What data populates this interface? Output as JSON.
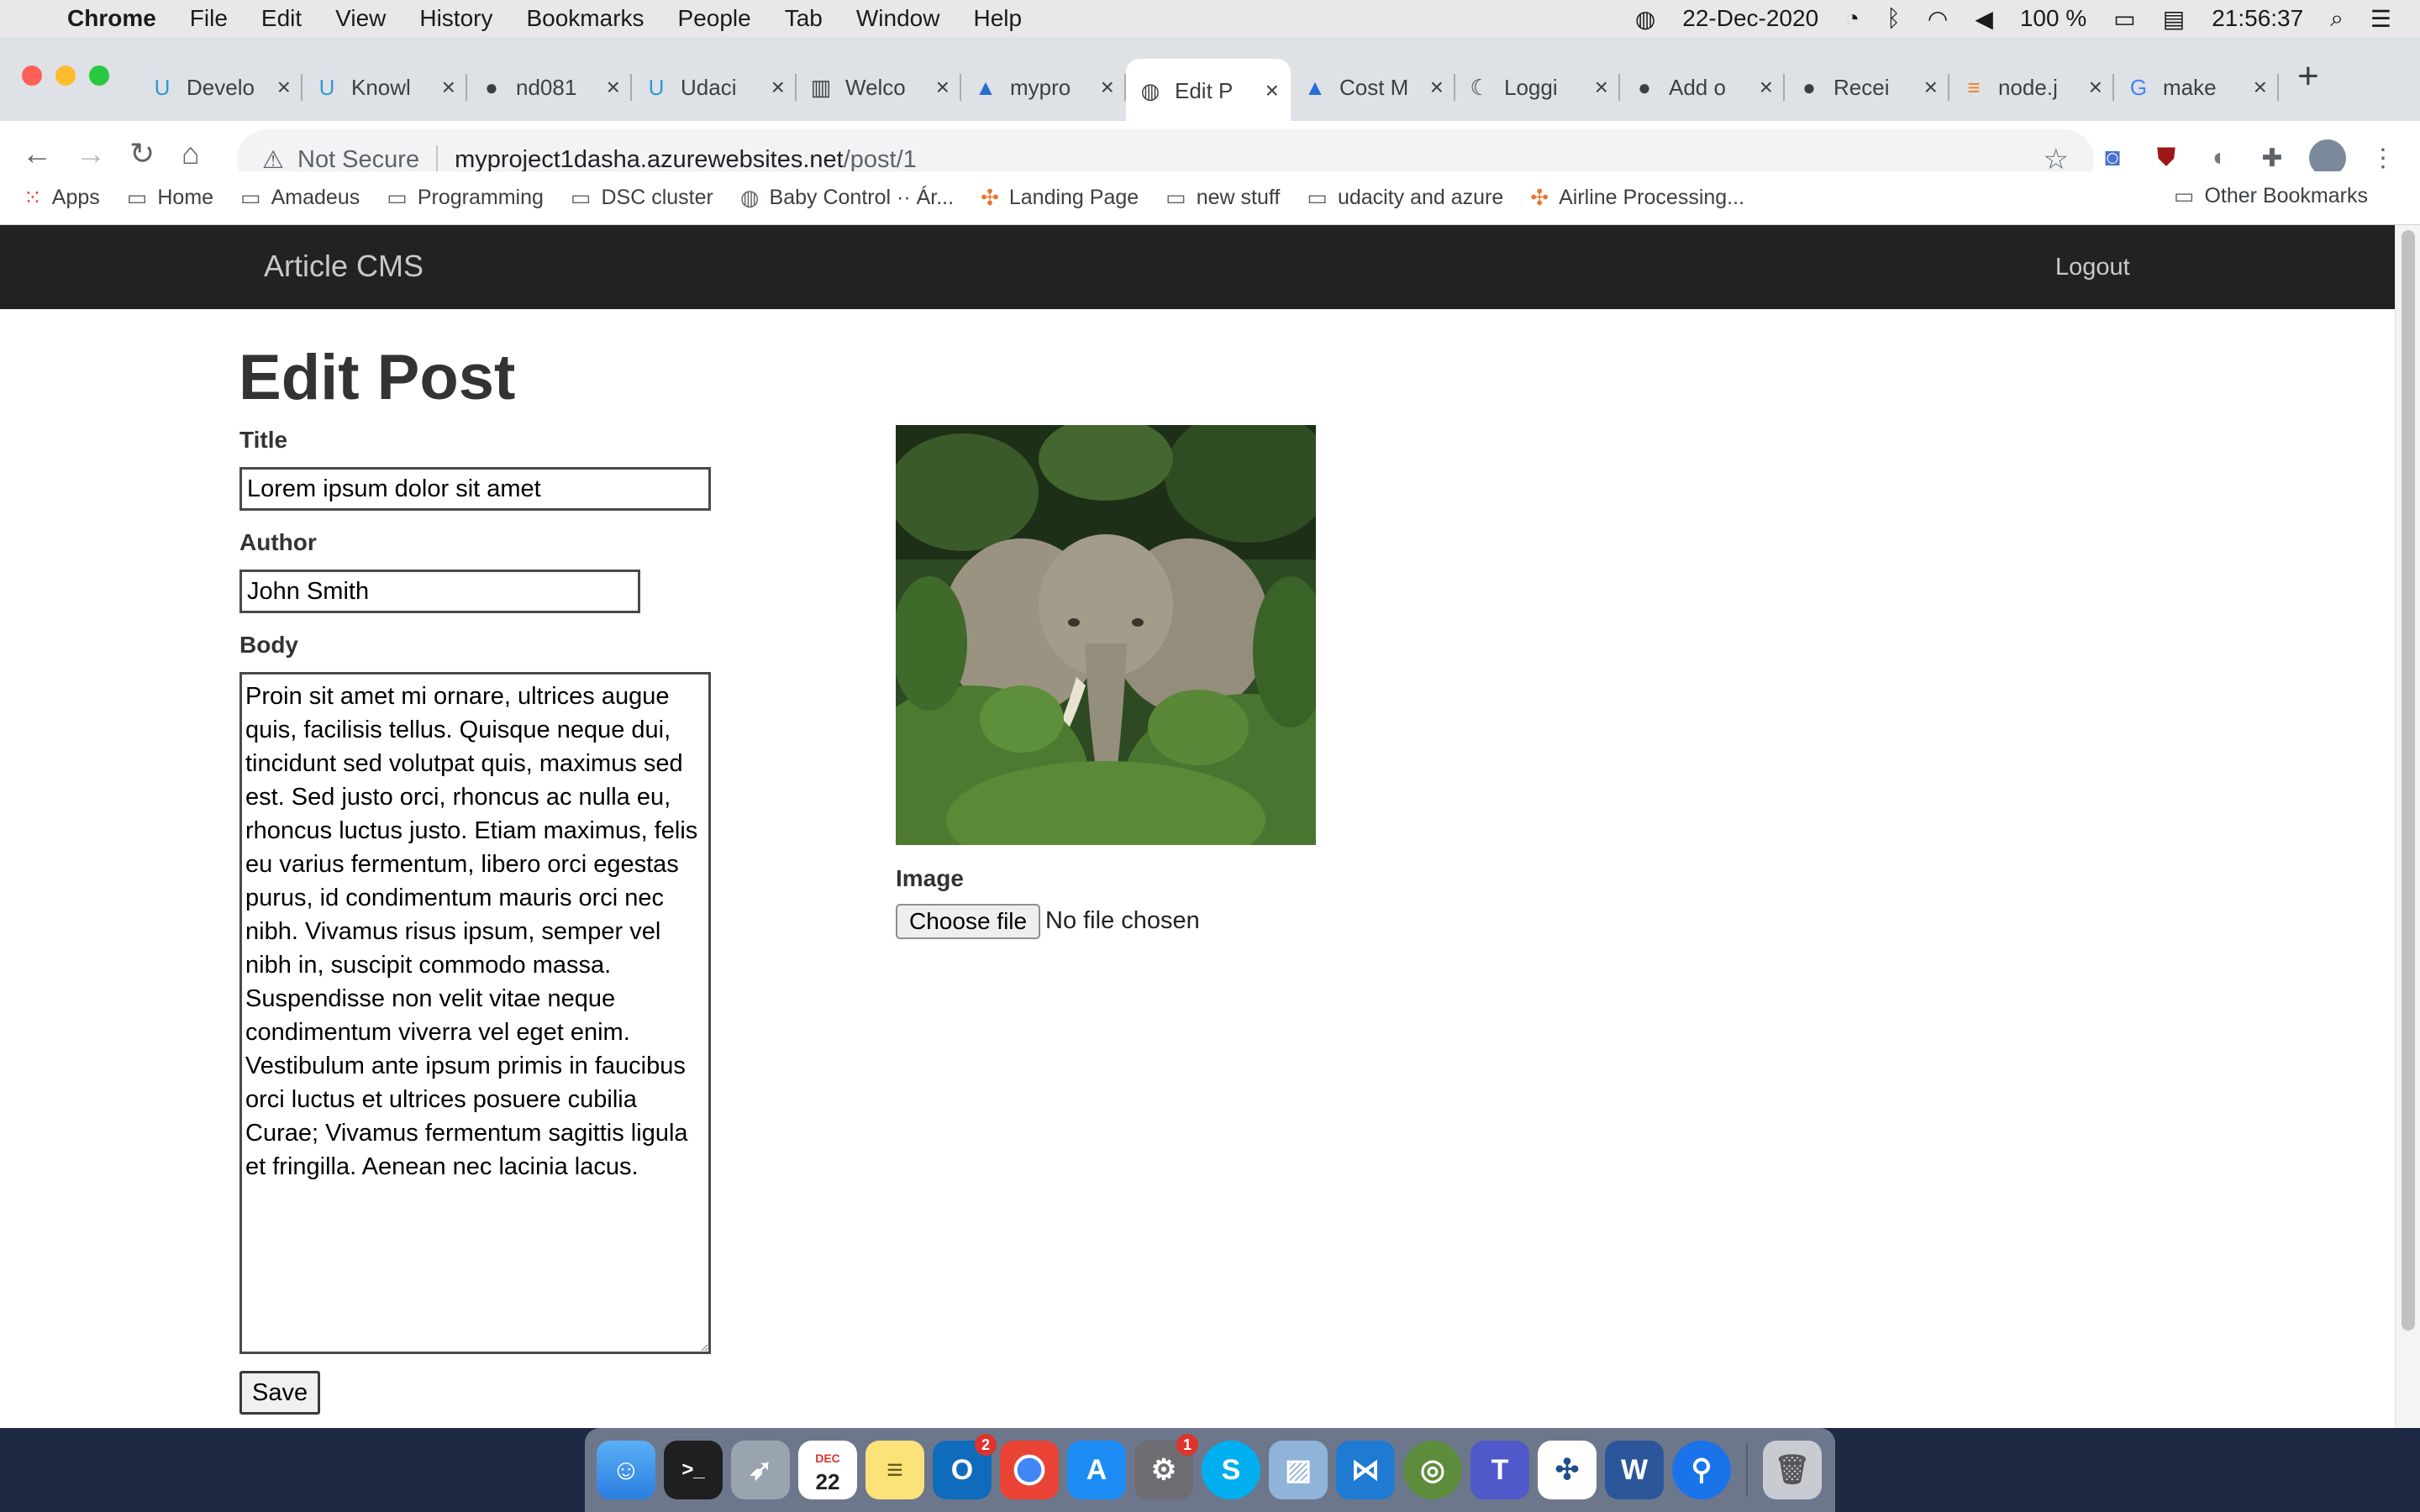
{
  "menubar": {
    "apple": "",
    "app_name": "Chrome",
    "items": [
      "File",
      "Edit",
      "View",
      "History",
      "Bookmarks",
      "People",
      "Tab",
      "Window",
      "Help"
    ],
    "date": "22-Dec-2020",
    "battery": "100 %",
    "time": "21:56:37"
  },
  "browser": {
    "tabs": [
      {
        "label": "Develo",
        "icon": "udacity-icon"
      },
      {
        "label": "Knowl",
        "icon": "udacity-icon"
      },
      {
        "label": "nd081",
        "icon": "github-icon"
      },
      {
        "label": "Udaci",
        "icon": "udacity-icon"
      },
      {
        "label": "Welco",
        "icon": "book-icon"
      },
      {
        "label": "mypro",
        "icon": "azure-icon"
      },
      {
        "label": "Edit P",
        "icon": "globe-icon",
        "active": true
      },
      {
        "label": "Cost M",
        "icon": "azure-icon"
      },
      {
        "label": "Loggi",
        "icon": "logging-icon"
      },
      {
        "label": "Add o",
        "icon": "github-icon"
      },
      {
        "label": "Recei",
        "icon": "github-icon"
      },
      {
        "label": "node.j",
        "icon": "stackoverflow-icon"
      },
      {
        "label": "make",
        "icon": "google-icon"
      }
    ],
    "address": {
      "security": "Not Secure",
      "host": "myproject1dasha.azurewebsites.net",
      "path": "/post/1"
    },
    "bookmarks": [
      {
        "label": "Apps",
        "icon": "apps-grid-icon"
      },
      {
        "label": "Home",
        "icon": "folder-icon"
      },
      {
        "label": "Amadeus",
        "icon": "folder-icon"
      },
      {
        "label": "Programming",
        "icon": "folder-icon"
      },
      {
        "label": "DSC cluster",
        "icon": "folder-icon"
      },
      {
        "label": "Baby Control ·· Ár...",
        "icon": "globe-icon"
      },
      {
        "label": "Landing Page",
        "icon": "tableau-icon"
      },
      {
        "label": "new stuff",
        "icon": "folder-icon"
      },
      {
        "label": "udacity and azure",
        "icon": "folder-icon"
      },
      {
        "label": "Airline Processing...",
        "icon": "tableau-icon"
      }
    ],
    "other_bookmarks": "Other Bookmarks"
  },
  "site": {
    "brand": "Article CMS",
    "logout": "Logout"
  },
  "form": {
    "heading": "Edit Post",
    "title_label": "Title",
    "title_value": "Lorem ipsum dolor sit amet",
    "author_label": "Author",
    "author_value": "John Smith",
    "body_label": "Body",
    "body_value": "Proin sit amet mi ornare, ultrices augue quis, facilisis tellus. Quisque neque dui, tincidunt sed volutpat quis, maximus sed est. Sed justo orci, rhoncus ac nulla eu, rhoncus luctus justo. Etiam maximus, felis eu varius fermentum, libero orci egestas purus, id condimentum mauris orci nec nibh. Vivamus risus ipsum, semper vel nibh in, suscipit commodo massa. Suspendisse non velit vitae neque condimentum viverra vel eget enim. Vestibulum ante ipsum primis in faucibus orci luctus et ultrices posuere cubilia Curae; Vivamus fermentum sagittis ligula et fringilla. Aenean nec lacinia lacus.",
    "image_label": "Image",
    "choose_file": "Choose file",
    "file_status": "No file chosen",
    "save_label": "Save"
  },
  "dock": {
    "calendar_month": "DEC",
    "calendar_day": "22",
    "outlook_badge": "2",
    "settings_badge": "1"
  },
  "colors": {
    "navbar": "#222222",
    "page_bg": "#ffffff",
    "tabstrip": "#dee1e6"
  }
}
